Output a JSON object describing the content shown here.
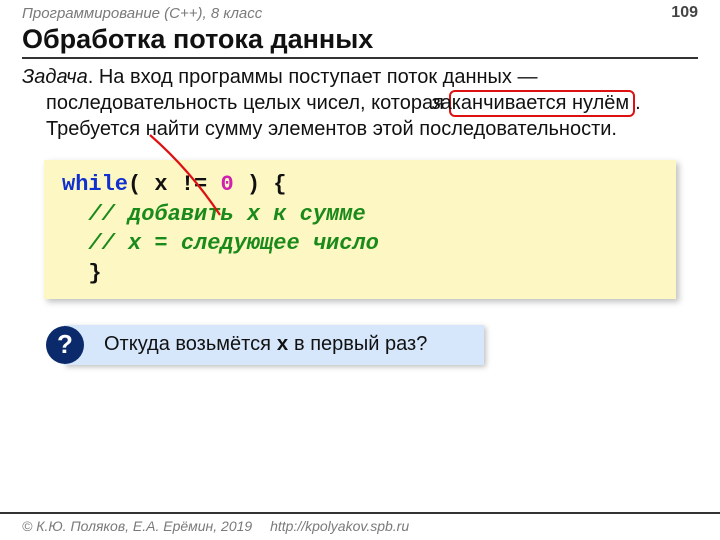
{
  "header": {
    "course": "Программирование (C++), 8 класс",
    "page_number": "109"
  },
  "title": "Обработка потока данных",
  "body": {
    "task_label": "Задача",
    "text_before_hl": ". На вход программы поступает поток данных — последовательность целых чисел, которая ",
    "highlight": "заканчивается нулём",
    "text_after_hl": ". Требуется найти сумму элементов этой последовательности."
  },
  "code": {
    "kw_while": "while",
    "cond_open": "( x != ",
    "zero": "0",
    "cond_close": " ) {",
    "comment1": "// добавить x к сумме",
    "comment2": "// x = следующее число",
    "brace": "}"
  },
  "question": {
    "mark": "?",
    "before_x": "Откуда возьмётся ",
    "x": "x",
    "after_x": " в первый раз?"
  },
  "footer": {
    "copyright": "© К.Ю. Поляков, Е.А. Ерёмин, 2019",
    "url": "http://kpolyakov.spb.ru"
  }
}
